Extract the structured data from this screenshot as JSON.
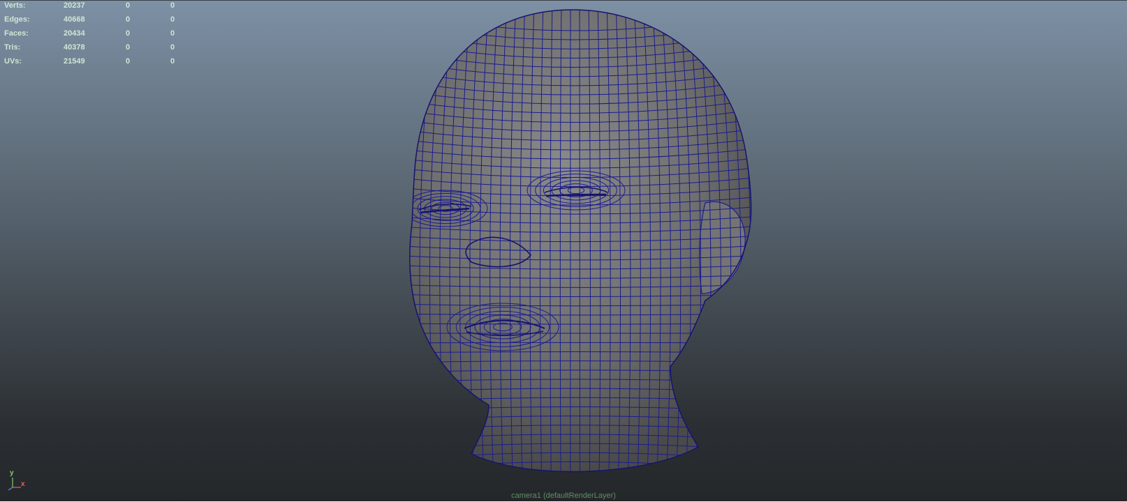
{
  "hud": {
    "rows": [
      {
        "label": "Verts:",
        "v1": "20237",
        "v2": "0",
        "v3": "0"
      },
      {
        "label": "Edges:",
        "v1": "40668",
        "v2": "0",
        "v3": "0"
      },
      {
        "label": "Faces:",
        "v1": "20434",
        "v2": "0",
        "v3": "0"
      },
      {
        "label": "Tris:",
        "v1": "40378",
        "v2": "0",
        "v3": "0"
      },
      {
        "label": "UVs:",
        "v1": "21549",
        "v2": "0",
        "v3": "0"
      }
    ]
  },
  "camera": {
    "label": "camera1 (defaultRenderLayer)"
  },
  "axis": {
    "y": "y",
    "x": "x",
    "z": "z"
  },
  "colors": {
    "wire": "#1b1b8f",
    "mesh": "#777777",
    "hud_text": "#cfe7d3",
    "camera_text": "#5e8f63"
  },
  "viewport_object": {
    "icon": "head-mesh-icon"
  }
}
